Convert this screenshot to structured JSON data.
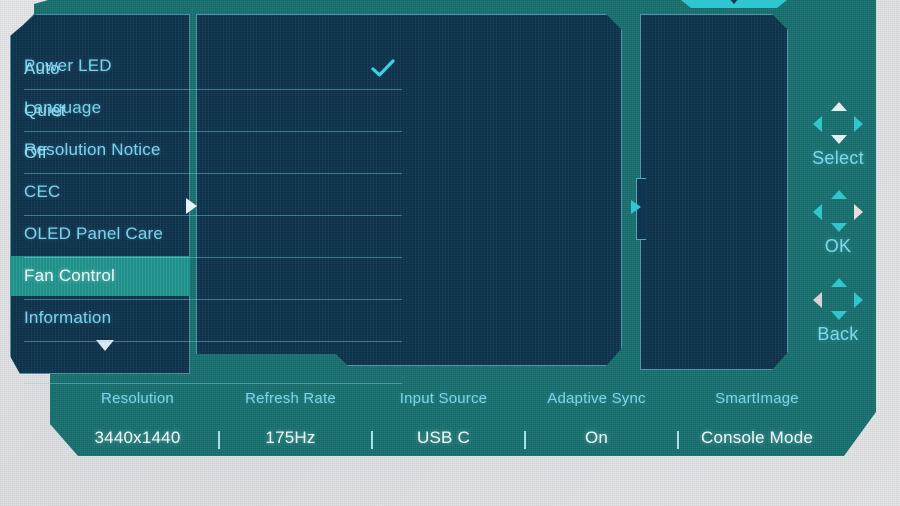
{
  "osd": {
    "device_type": "monitor-on-screen-display",
    "top_tab_icon": "chevron-down-icon",
    "panel_arrow_icon": "triangle-right-icon",
    "scroll_down_icon": "triangle-down-icon",
    "colors": {
      "panel_bg": "#0f3550",
      "frame_teal": "#15706e",
      "accent_cyan": "#2fc6cf",
      "text_cyan": "#79d4ea",
      "highlight_row": "#21968f",
      "text_white": "#f2f8fa",
      "page_bg": "#e4e6e8"
    }
  },
  "sidebar": {
    "items": [
      {
        "label": "Power LED",
        "selected": false
      },
      {
        "label": "Language",
        "selected": false
      },
      {
        "label": "Resolution Notice",
        "selected": false
      },
      {
        "label": "CEC",
        "selected": false
      },
      {
        "label": "OLED Panel Care",
        "selected": false
      },
      {
        "label": "Fan Control",
        "selected": true
      },
      {
        "label": "Information",
        "selected": false
      }
    ]
  },
  "options": {
    "title": "Fan Control",
    "rows": [
      {
        "label": "Auto",
        "checked": true
      },
      {
        "label": "Quiet",
        "checked": false
      },
      {
        "label": "Off",
        "checked": false
      },
      {
        "label": "",
        "checked": false
      },
      {
        "label": "",
        "checked": false
      },
      {
        "label": "",
        "checked": false
      },
      {
        "label": "",
        "checked": false
      },
      {
        "label": "",
        "checked": false
      }
    ],
    "check_icon": "check-icon"
  },
  "detail_panel": {
    "content": ""
  },
  "nav": {
    "clusters": [
      {
        "label": "Select",
        "up": true,
        "down": true,
        "left": false,
        "right": false
      },
      {
        "label": "OK",
        "up": false,
        "down": false,
        "left": false,
        "right": true
      },
      {
        "label": "Back",
        "up": false,
        "down": false,
        "left": true,
        "right": false
      }
    ]
  },
  "status": {
    "columns": [
      {
        "label": "Resolution",
        "value": "3440x1440"
      },
      {
        "label": "Refresh Rate",
        "value": "175Hz"
      },
      {
        "label": "Input Source",
        "value": "USB C"
      },
      {
        "label": "Adaptive Sync",
        "value": "On"
      },
      {
        "label": "SmartImage",
        "value": "Console Mode"
      }
    ]
  }
}
